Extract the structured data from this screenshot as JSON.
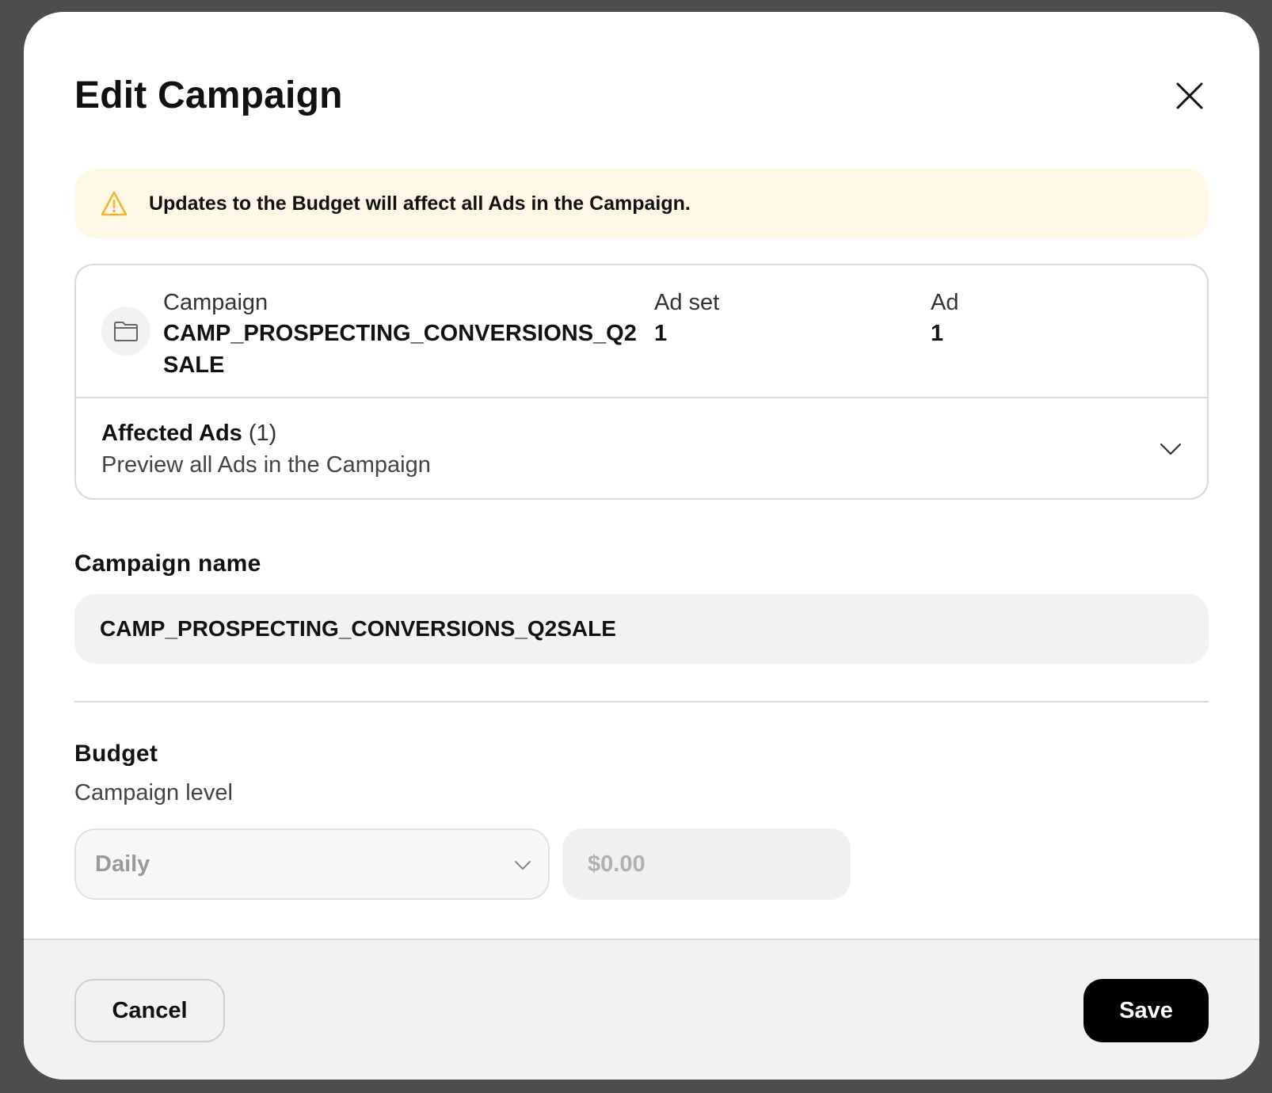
{
  "modal": {
    "title": "Edit Campaign",
    "close_icon": "close-icon"
  },
  "warning": {
    "icon": "warning-triangle-icon",
    "text": "Updates to the Budget will affect all Ads in the Campaign.",
    "color": "#f0b429"
  },
  "summary": {
    "icon": "folder-icon",
    "campaign_label": "Campaign",
    "campaign_value": "CAMP_PROSPECTING_CONVERSIONS_Q2SALE",
    "adset_label": "Ad set",
    "adset_value": "1",
    "ad_label": "Ad",
    "ad_value": "1"
  },
  "affected_ads": {
    "title": "Affected Ads",
    "count": "(1)",
    "subtitle": "Preview all Ads in the Campaign",
    "icon": "chevron-down-icon"
  },
  "campaign_name": {
    "label": "Campaign name",
    "value": "CAMP_PROSPECTING_CONVERSIONS_Q2SALE"
  },
  "budget": {
    "label": "Budget",
    "sublabel": "Campaign level",
    "period_selected": "Daily",
    "amount_placeholder": "$0.00"
  },
  "footer": {
    "cancel_label": "Cancel",
    "save_label": "Save"
  }
}
